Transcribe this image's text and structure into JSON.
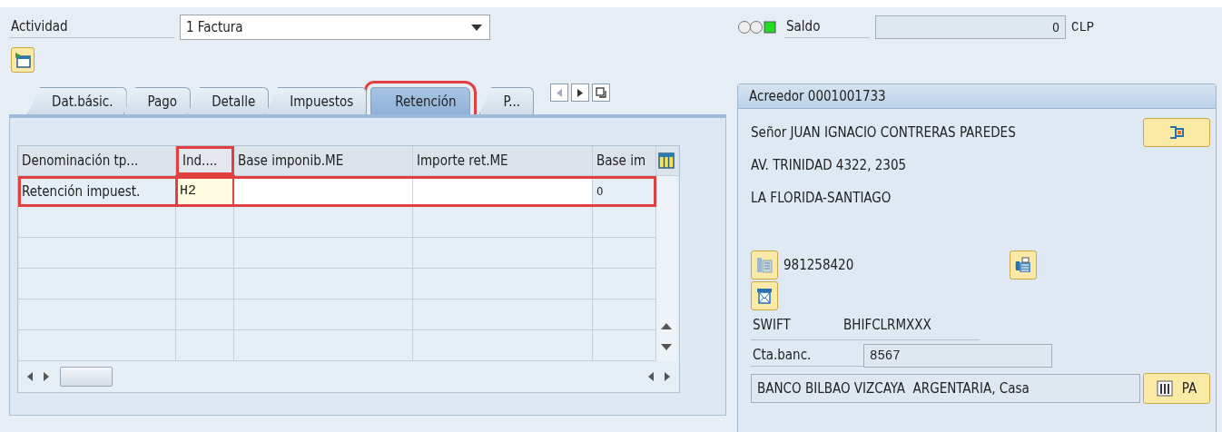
{
  "activity": {
    "label": "Actividad",
    "value": "1 Factura"
  },
  "balance": {
    "balanced": true,
    "label": "Saldo",
    "value": "0",
    "currency": "CLP"
  },
  "tabs": [
    {
      "label": "Dat.básic.",
      "selected": false,
      "highlighted": false
    },
    {
      "label": "Pago",
      "selected": false,
      "highlighted": false
    },
    {
      "label": "Detalle",
      "selected": false,
      "highlighted": false
    },
    {
      "label": "Impuestos",
      "selected": false,
      "highlighted": false
    },
    {
      "label": "Retención",
      "selected": true,
      "highlighted": true
    },
    {
      "label": "P...",
      "selected": false,
      "highlighted": false
    }
  ],
  "table": {
    "columns": [
      {
        "label": "Denominación tp...",
        "highlighted": false
      },
      {
        "label": "Ind....",
        "highlighted": true
      },
      {
        "label": "Base imponib.ME",
        "highlighted": false
      },
      {
        "label": "Importe ret.ME",
        "highlighted": false
      },
      {
        "label": "Base im",
        "highlighted": false
      }
    ],
    "rows": [
      {
        "highlighted": true,
        "cells": [
          {
            "kind": "text",
            "text": "Retención impuest."
          },
          {
            "kind": "input",
            "text": "H2"
          },
          {
            "kind": "input"
          },
          {
            "kind": "input"
          },
          {
            "kind": "text",
            "text": "0"
          }
        ]
      }
    ]
  },
  "vendor": {
    "title": "Acreedor 0001001733",
    "lines": [
      "Señor JUAN IGNACIO CONTRERAS PAREDES",
      "AV. TRINIDAD 4322, 2305",
      "LA FLORIDA-SANTIAGO"
    ],
    "phone": "981258420",
    "swift": {
      "label": "SWIFT",
      "value": "BHIFCLRMXXX"
    },
    "account": {
      "label": "Cta.banc.",
      "value": "8567"
    },
    "bank": "BANCO BILBAO VIZCAYA  ARGENTARIA, Casa",
    "bank_button": "PA"
  }
}
